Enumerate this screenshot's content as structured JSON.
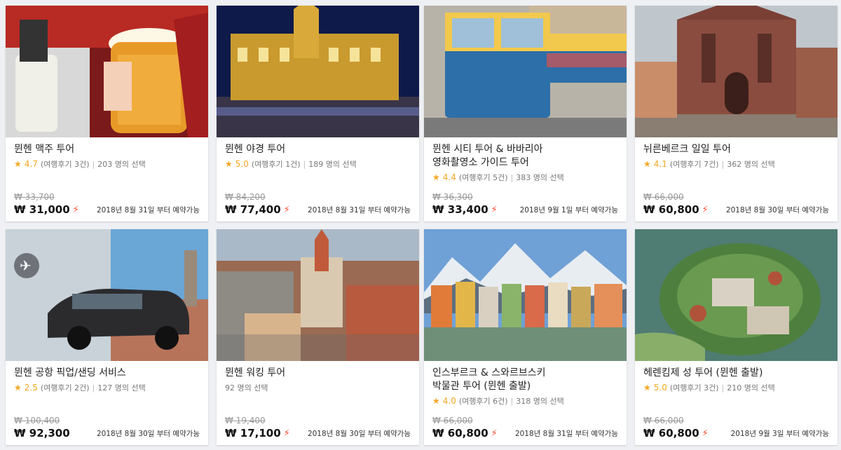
{
  "cards": [
    {
      "title": "뮌헨 맥주 투어",
      "rating": "4.7",
      "reviews": "(여행후기 3건)",
      "chosen": "203 명의 선택",
      "old_price": "₩ 33,700",
      "price": "₩ 31,000",
      "availability": "2018년 8월 31일 부터 예약가능"
    },
    {
      "title": "뮌헨 야경 투어",
      "rating": "5.0",
      "reviews": "(여행후기 1건)",
      "chosen": "189 명의 선택",
      "old_price": "₩ 84,200",
      "price": "₩ 77,400",
      "availability": "2018년 8월 31일 부터 예약가능"
    },
    {
      "title": "뮌헨 시티 투어 & 바바리아\n영화촬영소 가이드 투어",
      "rating": "4.4",
      "reviews": "(여행후기 5건)",
      "chosen": "383 명의 선택",
      "old_price": "₩ 36,300",
      "price": "₩ 33,400",
      "availability": "2018년 9월 1일 부터 예약가능"
    },
    {
      "title": "뉘른베르크 일일 투어",
      "rating": "4.1",
      "reviews": "(여행후기 7건)",
      "chosen": "362 명의 선택",
      "old_price": "₩ 66,000",
      "price": "₩ 60,800",
      "availability": "2018년 8월 30일 부터 예약가능"
    },
    {
      "title": "뮌헨 공항 픽업/샌딩 서비스",
      "rating": "2.5",
      "reviews": "(여행후기 2건)",
      "chosen": "127 명의 선택",
      "old_price": "₩ 100,400",
      "price": "₩ 92,300",
      "availability": "2018년 8월 30일 부터 예약가능"
    },
    {
      "title": "뮌헨 워킹 투어",
      "rating": "",
      "reviews": "",
      "chosen": "92 명의 선택",
      "old_price": "₩ 19,400",
      "price": "₩ 17,100",
      "availability": "2018년 8월 30일 부터 예약가능"
    },
    {
      "title": "인스부르크 & 스와르브스키\n박물관 투어 (뮌헨 출발)",
      "rating": "4.0",
      "reviews": "(여행후기 6건)",
      "chosen": "318 명의 선택",
      "old_price": "₩ 66,000",
      "price": "₩ 60,800",
      "availability": "2018년 8월 31일 부터 예약가능"
    },
    {
      "title": "헤렌킴제 성 투어 (뮌헨 출발)",
      "rating": "5.0",
      "reviews": "(여행후기 3건)",
      "chosen": "210 명의 선택",
      "old_price": "₩ 66,000",
      "price": "₩ 60,800",
      "availability": "2018년 9월 3일 부터 예약가능"
    }
  ],
  "colors": {
    "star": "#f5a623",
    "bolt": "#ff4a2d",
    "background": "#eef0f3"
  },
  "icons": {
    "star": "★",
    "bolt": "⚡",
    "airplane": "✈"
  }
}
